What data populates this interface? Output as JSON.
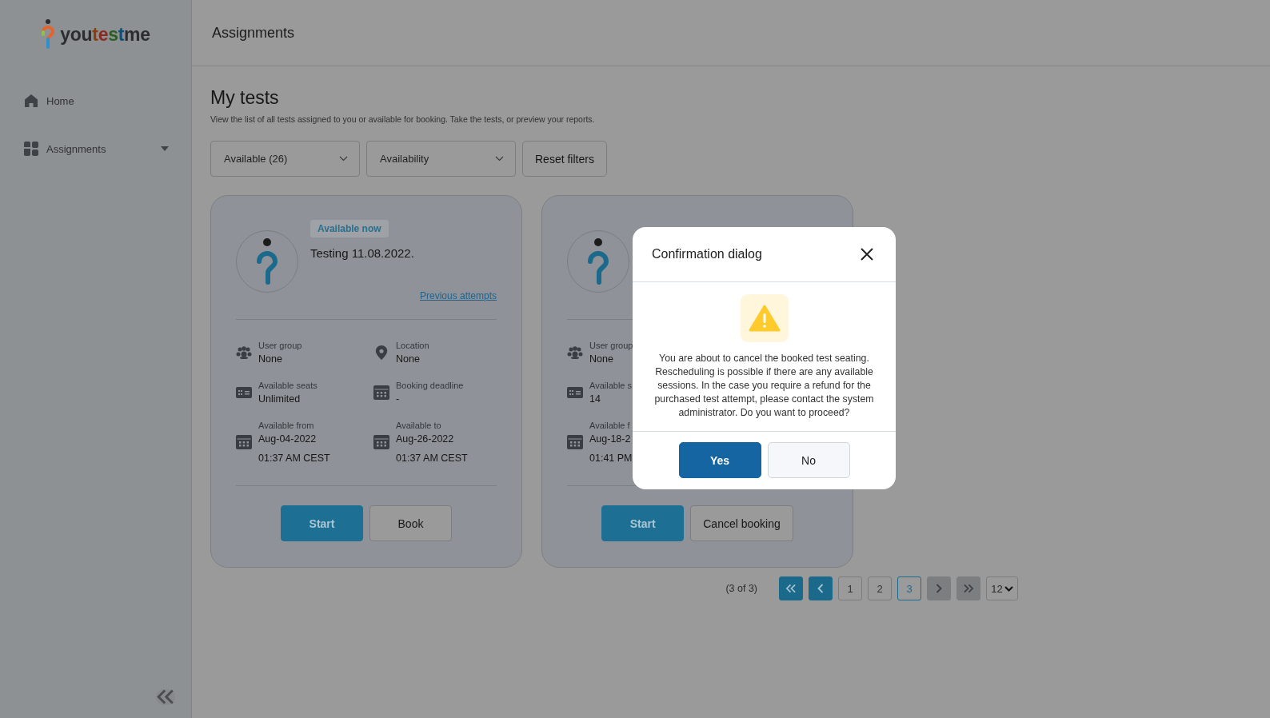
{
  "sidebar": {
    "logo": "youtestme",
    "items": [
      {
        "label": "Home"
      },
      {
        "label": "Assignments",
        "expanded": false
      }
    ]
  },
  "header": {
    "title": "Assignments"
  },
  "page": {
    "title": "My tests",
    "subtitle": "View the list of all tests assigned to you or available for booking. Take the tests, or preview your reports."
  },
  "filters": [
    {
      "value": "Available (26)"
    },
    {
      "value": "Availability"
    }
  ],
  "reset_button": "Reset filters",
  "cards": [
    {
      "badge": "Available now",
      "title": "Testing 11.08.2022.",
      "link": "Previous attempts",
      "rows": [
        [
          {
            "kind": "group",
            "label": "User group",
            "lines": [
              "None"
            ]
          },
          {
            "kind": "location",
            "label": "Location",
            "lines": [
              "None"
            ]
          }
        ],
        [
          {
            "kind": "seats",
            "label": "Available seats",
            "lines": [
              "Unlimited"
            ]
          },
          {
            "kind": "deadline",
            "label": "Booking deadline",
            "lines": [
              "-"
            ]
          }
        ],
        [
          {
            "kind": "date",
            "label": "Available from",
            "lines": [
              "Aug-04-2022",
              "01:37 AM CEST"
            ]
          },
          {
            "kind": "date",
            "label": "Available to",
            "lines": [
              "Aug-26-2022",
              "01:37 AM CEST"
            ]
          }
        ]
      ],
      "buttons": [
        {
          "label": "Start",
          "primary": true
        },
        {
          "label": "Book",
          "primary": false
        }
      ]
    },
    {
      "rows": [
        [
          {
            "kind": "group",
            "label": "User group",
            "lines": [
              "None"
            ]
          }
        ],
        [
          {
            "kind": "seats",
            "label": "Available s",
            "lines": [
              "14"
            ]
          }
        ],
        [
          {
            "kind": "date",
            "label": "Available f",
            "lines": [
              "Aug-18-2",
              "01:41 PM"
            ]
          }
        ]
      ],
      "buttons": [
        {
          "label": "Start",
          "primary": true
        },
        {
          "label": "Cancel booking",
          "primary": false
        }
      ]
    }
  ],
  "pagination": {
    "summary": "(3 of 3)",
    "first_disabled": false,
    "prev_disabled": false,
    "pages": [
      {
        "label": "1",
        "selected": false
      },
      {
        "label": "2",
        "selected": false
      },
      {
        "label": "3",
        "selected": true
      }
    ],
    "next_disabled": true,
    "last_disabled": true,
    "page_size": "12"
  },
  "dialog": {
    "title": "Confirmation dialog",
    "message": "You are about to cancel the booked test seating. Rescheduling is possible if there are any available sessions. In the case you require a refund for the purchased test attempt, please contact the system administrator. Do you want to proceed?",
    "buttons": [
      {
        "label": "Yes",
        "primary": true
      },
      {
        "label": "No",
        "primary": false
      }
    ]
  }
}
